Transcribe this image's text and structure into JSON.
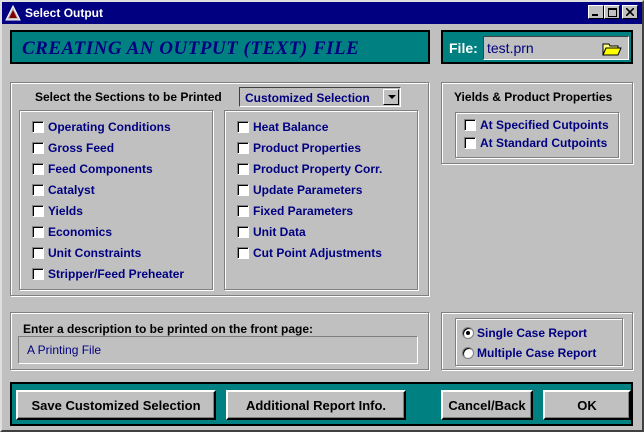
{
  "window": {
    "title": "Select Output",
    "controls": {
      "minimize": "_",
      "maximize": "□",
      "close": "✕"
    }
  },
  "header": {
    "title": "CREATING AN OUTPUT (TEXT)  FILE"
  },
  "file": {
    "label": "File:",
    "value": "test.prn",
    "browse_icon": "folder-open-icon"
  },
  "sections": {
    "label": "Select the Sections to be Printed",
    "selection_mode": "Customized Selection",
    "left_items": [
      "Operating Conditions",
      "Gross Feed",
      "Feed Components",
      "Catalyst",
      "Yields",
      "Economics",
      "Unit Constraints",
      "Stripper/Feed Preheater"
    ],
    "right_items": [
      "Heat Balance",
      "Product Properties",
      "Product Property Corr.",
      "Update Parameters",
      "Fixed Parameters",
      "Unit Data",
      "Cut Point Adjustments"
    ]
  },
  "yields": {
    "label": "Yields  &  Product Properties",
    "items": [
      "At Specified Cutpoints",
      "At Standard Cutpoints"
    ]
  },
  "description": {
    "label": "Enter a description to be printed on the front page:",
    "value": "A Printing File"
  },
  "report": {
    "options": [
      "Single Case Report",
      "Multiple Case Report"
    ],
    "selected": "Single Case Report"
  },
  "buttons": {
    "save": "Save Customized Selection",
    "additional": "Additional Report Info.",
    "cancel": "Cancel/Back",
    "ok": "OK"
  },
  "colors": {
    "titlebar": "#000080",
    "panel_teal": "#008080",
    "label_blue": "#000080",
    "face": "#c0c0c0"
  }
}
